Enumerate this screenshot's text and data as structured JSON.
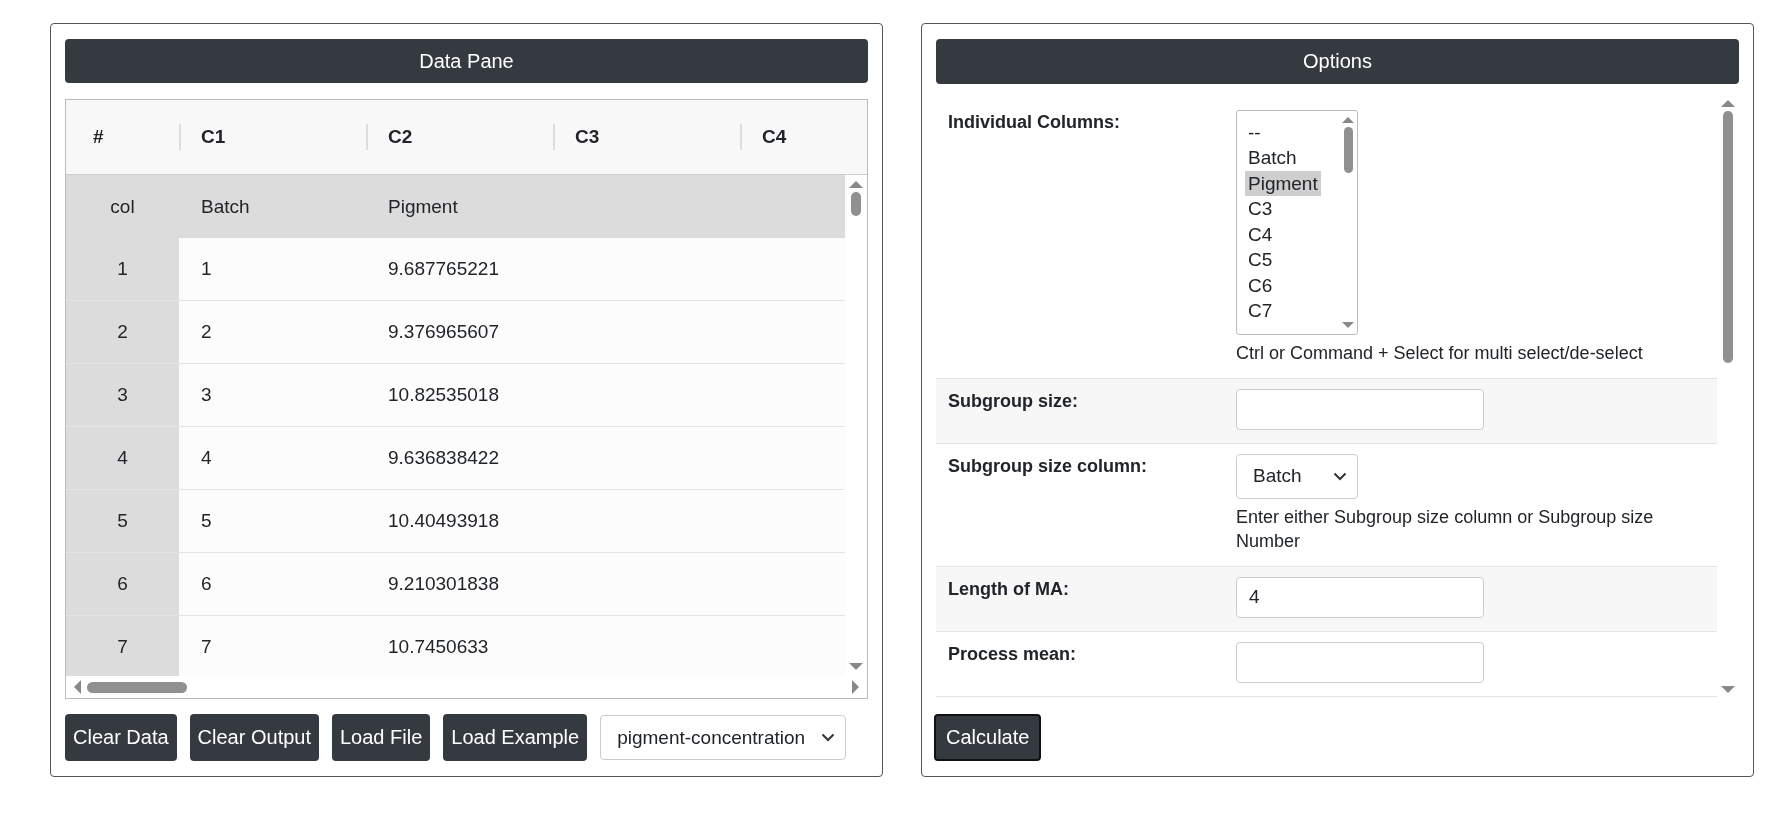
{
  "data_pane": {
    "title": "Data Pane",
    "columns": [
      "#",
      "C1",
      "C2",
      "C3",
      "C4"
    ],
    "rows": [
      {
        "kind": "names",
        "cells": [
          "col",
          "Batch",
          "Pigment"
        ]
      },
      {
        "kind": "data",
        "cells": [
          "1",
          "1",
          "9.687765221"
        ]
      },
      {
        "kind": "data",
        "cells": [
          "2",
          "2",
          "9.376965607"
        ]
      },
      {
        "kind": "data",
        "cells": [
          "3",
          "3",
          "10.82535018"
        ]
      },
      {
        "kind": "data",
        "cells": [
          "4",
          "4",
          "9.636838422"
        ]
      },
      {
        "kind": "data",
        "cells": [
          "5",
          "5",
          "10.40493918"
        ]
      },
      {
        "kind": "data",
        "cells": [
          "6",
          "6",
          "9.210301838"
        ]
      },
      {
        "kind": "data",
        "cells": [
          "7",
          "7",
          "10.7450633"
        ]
      }
    ],
    "buttons": [
      "Clear Data",
      "Clear Output",
      "Load File",
      "Load Example"
    ],
    "example_select": {
      "value": "pigment-concentration"
    }
  },
  "options": {
    "title": "Options",
    "fields": [
      {
        "kind": "listbox",
        "label": "Individual Columns:",
        "options": [
          {
            "label": "--",
            "selected": false
          },
          {
            "label": "Batch",
            "selected": false
          },
          {
            "label": "Pigment",
            "selected": true
          },
          {
            "label": "C3",
            "selected": false
          },
          {
            "label": "C4",
            "selected": false
          },
          {
            "label": "C5",
            "selected": false
          },
          {
            "label": "C6",
            "selected": false
          },
          {
            "label": "C7",
            "selected": false
          }
        ],
        "hint": "Ctrl or Command + Select for multi select/de-select"
      },
      {
        "kind": "input",
        "label": "Subgroup size:"
      },
      {
        "kind": "select",
        "label": "Subgroup size column:",
        "value": "Batch",
        "hint": "Enter either Subgroup size column or Subgroup size Number"
      },
      {
        "kind": "input",
        "label": "Length of MA:",
        "value": "4"
      },
      {
        "kind": "input",
        "label": "Process mean:"
      }
    ],
    "button": "Calculate"
  }
}
